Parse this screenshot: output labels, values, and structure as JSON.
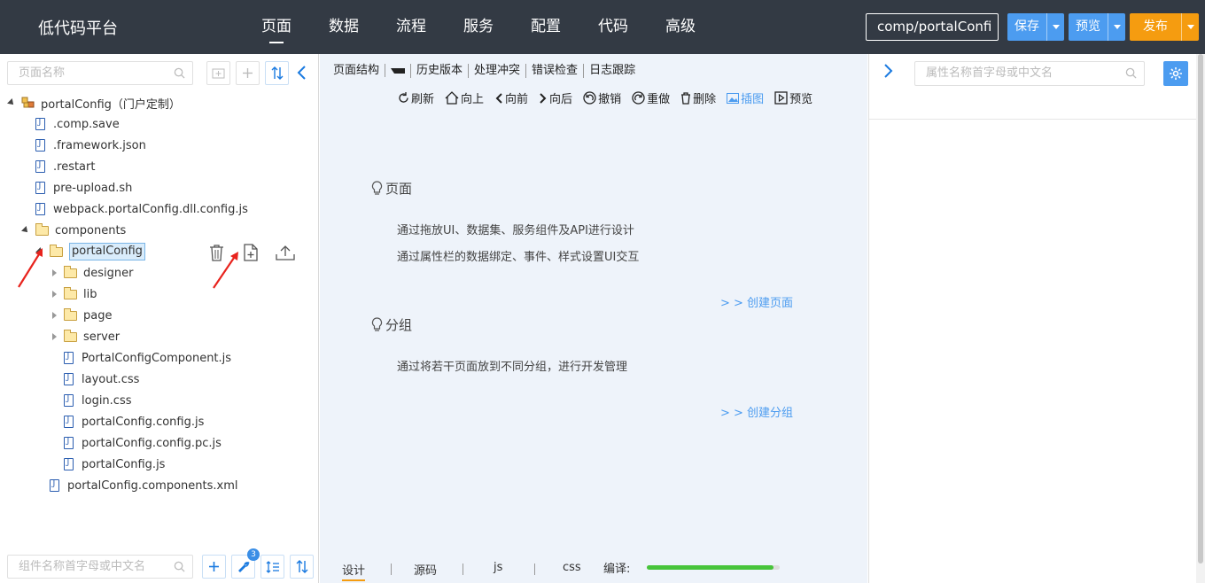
{
  "app": {
    "brand": "低代码平台",
    "nav": [
      "页面",
      "数据",
      "流程",
      "服务",
      "配置",
      "代码",
      "高级"
    ],
    "active_nav": "页面",
    "path": "comp/portalConfi",
    "save_label": "保存",
    "preview_label": "预览",
    "publish_label": "发布"
  },
  "left": {
    "search_placeholder": "页面名称",
    "tree": [
      {
        "label": "portalConfig（门户定制）",
        "type": "project",
        "toggle": "open"
      },
      {
        "label": ".comp.save",
        "type": "file"
      },
      {
        "label": ".framework.json",
        "type": "file"
      },
      {
        "label": ".restart",
        "type": "file"
      },
      {
        "label": "pre-upload.sh",
        "type": "file"
      },
      {
        "label": "webpack.portalConfig.dll.config.js",
        "type": "file"
      },
      {
        "label": "components",
        "type": "folder",
        "toggle": "open"
      },
      {
        "label": "portalConfig",
        "type": "folder",
        "toggle": "open",
        "selected": true
      },
      {
        "label": "designer",
        "type": "folder",
        "toggle": "closed"
      },
      {
        "label": "lib",
        "type": "folder",
        "toggle": "closed"
      },
      {
        "label": "page",
        "type": "folder",
        "toggle": "closed"
      },
      {
        "label": "server",
        "type": "folder",
        "toggle": "closed"
      },
      {
        "label": "PortalConfigComponent.js",
        "type": "file"
      },
      {
        "label": "layout.css",
        "type": "file"
      },
      {
        "label": "login.css",
        "type": "file"
      },
      {
        "label": "portalConfig.config.js",
        "type": "file"
      },
      {
        "label": "portalConfig.config.pc.js",
        "type": "file"
      },
      {
        "label": "portalConfig.js",
        "type": "file"
      },
      {
        "label": "portalConfig.components.xml",
        "type": "file"
      }
    ],
    "bottom_search_placeholder": "组件名称首字母或中文名",
    "badge_count": "3"
  },
  "center": {
    "tabs": [
      "页面结构",
      "历史版本",
      "处理冲突",
      "错误检查",
      "日志跟踪"
    ],
    "toolbar": [
      "刷新",
      "向上",
      "向前",
      "向后",
      "撤销",
      "重做",
      "删除",
      "插图",
      "预览"
    ],
    "active_tool": "插图",
    "sections": [
      {
        "title": "页面",
        "lines": [
          "通过拖放UI、数据集、服务组件及API进行设计",
          "通过属性栏的数据绑定、事件、样式设置UI交互"
        ],
        "link": "> > 创建页面"
      },
      {
        "title": "分组",
        "lines": [
          "通过将若干页面放到不同分组，进行开发管理"
        ],
        "link": "> > 创建分组"
      }
    ],
    "bottom_tabs": [
      "设计",
      "源码",
      "js",
      "css"
    ],
    "active_bottom_tab": "设计",
    "compile_label": "编译:",
    "compile_progress": 0.95
  },
  "right": {
    "search_placeholder": "属性名称首字母或中文名"
  }
}
